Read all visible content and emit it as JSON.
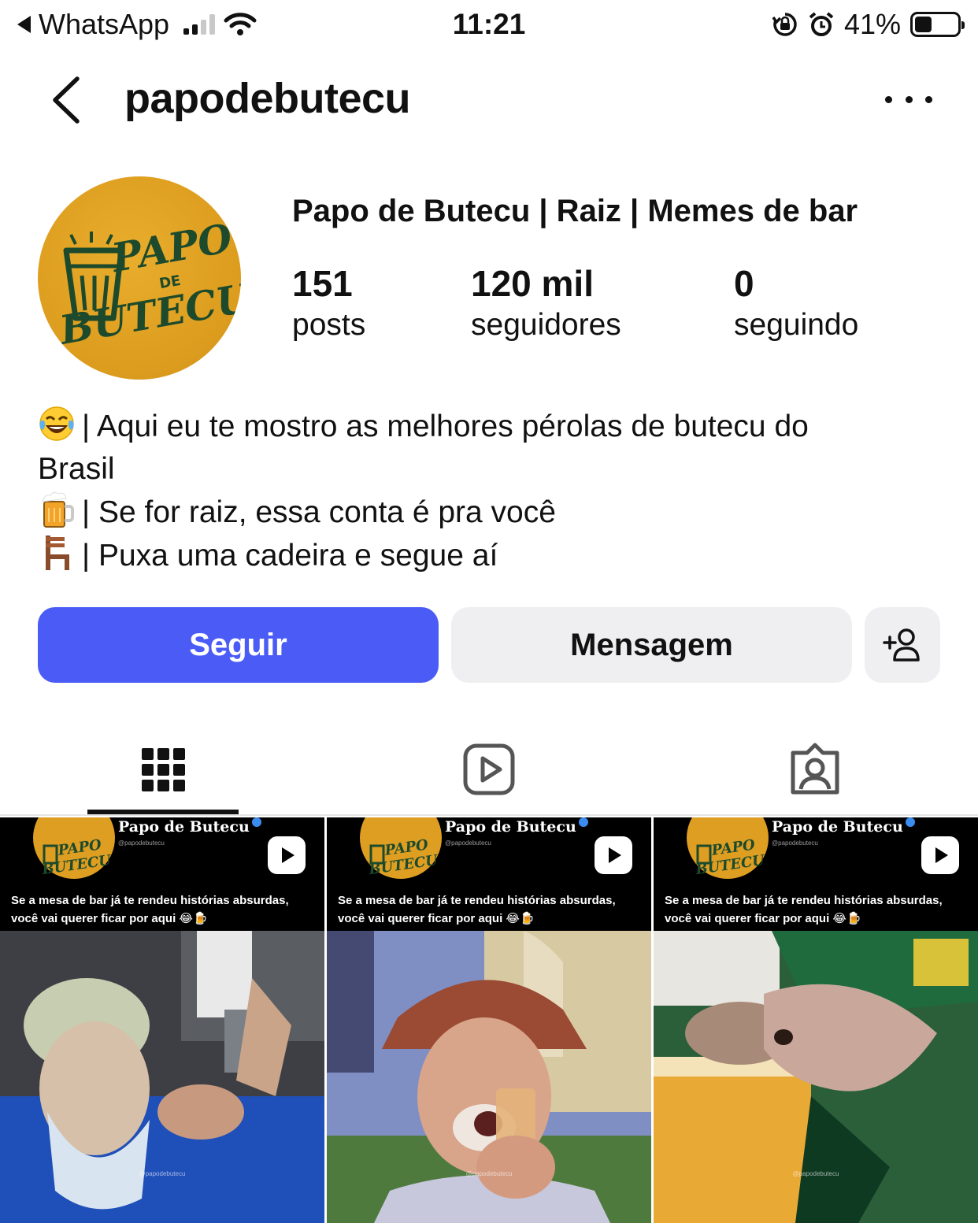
{
  "status_bar": {
    "back_app": "WhatsApp",
    "time": "11:21",
    "battery": "41%",
    "battery_level": 0.41,
    "signal_bars": 2
  },
  "header": {
    "username": "papodebutecu"
  },
  "profile": {
    "display_name": "Papo de Butecu | Raiz | Memes de bar",
    "avatar_text_top": "PAPO",
    "avatar_text_mid": "DE",
    "avatar_text_bottom": "BUTECU",
    "stats": [
      {
        "value": "151",
        "label": "posts"
      },
      {
        "value": "120 mil",
        "label": "seguidores"
      },
      {
        "value": "0",
        "label": "seguindo"
      }
    ],
    "bio": [
      {
        "icon": "laughing-tears-icon",
        "text": "| Aqui eu te mostro as melhores pérolas de butecu do"
      },
      {
        "icon": "",
        "text": "Brasil"
      },
      {
        "icon": "beer-mug-icon",
        "text": "| Se for raiz, essa conta é pra você"
      },
      {
        "icon": "chair-icon",
        "text": "| Puxa uma cadeira e segue aí"
      }
    ]
  },
  "actions": {
    "follow_label": "Seguir",
    "message_label": "Mensagem",
    "follow_color": "#4b5cf6"
  },
  "tabs": [
    {
      "icon": "grid-icon",
      "active": true
    },
    {
      "icon": "reels-icon",
      "active": false
    },
    {
      "icon": "tagged-icon",
      "active": false
    }
  ],
  "posts": [
    {
      "channel": "Papo de Butecu",
      "handle": "@papodebutecu",
      "caption_line1": "Se a mesa de bar já te rendeu histórias absurdas,",
      "caption_line2": "você vai querer ficar por aqui",
      "watermark": "@papodebutecu"
    },
    {
      "channel": "Papo de Butecu",
      "handle": "@papodebutecu",
      "caption_line1": "Se a mesa de bar já te rendeu histórias absurdas,",
      "caption_line2": "você vai querer ficar por aqui",
      "watermark": "@papodebutecu"
    },
    {
      "channel": "Papo de Butecu",
      "handle": "@papodebutecu",
      "caption_line1": "Se a mesa de bar já te rendeu histórias absurdas,",
      "caption_line2": "você vai querer ficar por aqui",
      "watermark": "@papodebutecu"
    }
  ]
}
